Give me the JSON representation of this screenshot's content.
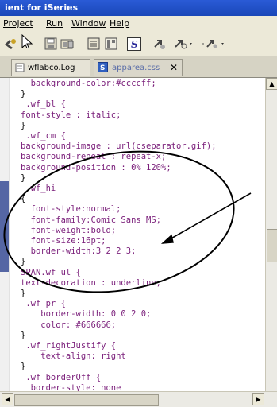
{
  "window": {
    "title": "ient for iSeries"
  },
  "menu": [
    "Project",
    "Run",
    "Window",
    "Help"
  ],
  "toolbar": {
    "icons": [
      "run-icon",
      "select-arrow-icon",
      "save-icon",
      "open-icon",
      "build-icon",
      "style-s-icon",
      "link-icon",
      "search-icon",
      "tool-icon"
    ]
  },
  "tabs": [
    {
      "label": "wflabco.Log",
      "active": false
    },
    {
      "label": "apparea.css",
      "active": true,
      "close": "✕"
    }
  ],
  "code": [
    {
      "text": "  background-color:#ccccff;",
      "kind": "prop"
    },
    {
      "text": "}",
      "kind": "brace"
    },
    {
      "text": " .wf_bl {",
      "kind": "sel"
    },
    {
      "text": "font-style : italic;",
      "kind": "prop"
    },
    {
      "text": "}",
      "kind": "brace"
    },
    {
      "text": " .wf_cm {",
      "kind": "sel"
    },
    {
      "text": "background-image : url(cseparator.gif);",
      "kind": "prop"
    },
    {
      "text": "background-repeat : repeat-x;",
      "kind": "prop"
    },
    {
      "text": "background-position : 0% 120%;",
      "kind": "prop"
    },
    {
      "text": "}",
      "kind": "brace"
    },
    {
      "text": " .wf_hi",
      "kind": "sel"
    },
    {
      "text": "{",
      "kind": "brace"
    },
    {
      "text": "  font-style:normal;",
      "kind": "prop"
    },
    {
      "text": "  font-family:Comic Sans MS;",
      "kind": "prop"
    },
    {
      "text": "  font-weight:bold;",
      "kind": "prop"
    },
    {
      "text": "  font-size:16pt;",
      "kind": "prop"
    },
    {
      "text": "  border-width:3 2 2 3;",
      "kind": "prop"
    },
    {
      "text": "}",
      "kind": "brace"
    },
    {
      "text": "SPAN.wf_ul {",
      "kind": "sel"
    },
    {
      "text": "text-decoration : underline;",
      "kind": "prop"
    },
    {
      "text": "}",
      "kind": "brace"
    },
    {
      "text": " .wf_pr {",
      "kind": "sel"
    },
    {
      "text": "    border-width: 0 0 2 0;",
      "kind": "prop"
    },
    {
      "text": "    color: #666666;",
      "kind": "prop"
    },
    {
      "text": "}",
      "kind": "brace"
    },
    {
      "text": " .wf_rightJustify {",
      "kind": "sel"
    },
    {
      "text": "    text-align: right",
      "kind": "prop"
    },
    {
      "text": "}",
      "kind": "brace"
    },
    {
      "text": " .wf_borderOff {",
      "kind": "sel"
    },
    {
      "text": "  border-style: none",
      "kind": "prop"
    }
  ],
  "colors": {
    "selector": "#7a1e7a",
    "gutter_marker": "#5566a4",
    "title_bar": "#1947b8",
    "annotation": "#000000"
  }
}
